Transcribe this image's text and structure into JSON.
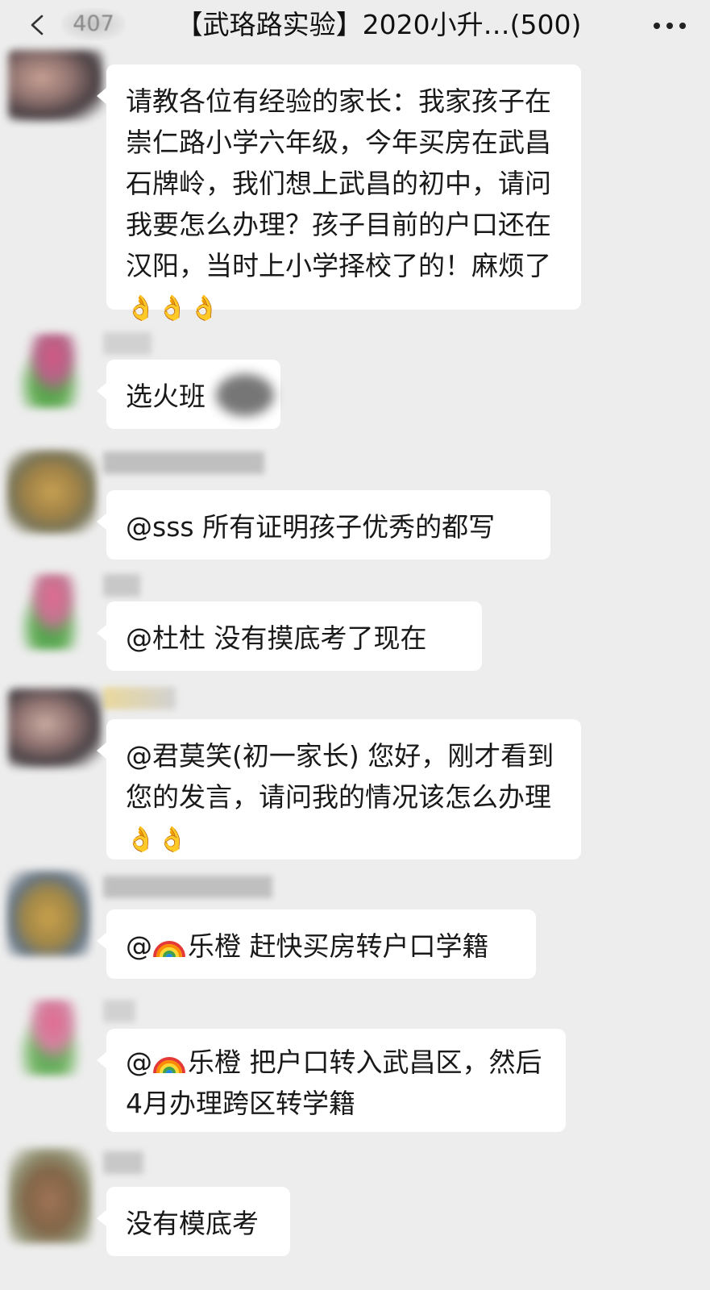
{
  "header": {
    "back_count": "407",
    "title": "【武珞路实验】2020小升…(500)"
  },
  "messages": [
    {
      "text": "请教各位有经验的家长：我家孩子在崇仁路小学六年级，今年买房在武昌石牌岭，我们想上武昌的初中，请问我要怎么办理？孩子目前的户口还在汉阳，当时上小学择校了的！麻烦了",
      "emoji": "👌👌👌"
    },
    {
      "text": "选火班"
    },
    {
      "text": "@sss 所有证明孩子优秀的都写"
    },
    {
      "text": "@杜杜 没有摸底考了现在"
    },
    {
      "text": "@君莫笑(初一家长) 您好，刚才看到您的发言，请问我的情况该怎么办理",
      "emoji": "👌👌"
    },
    {
      "mention_prefix": "@",
      "mention_name": "乐橙",
      "text": " 赶快买房转户口学籍"
    },
    {
      "mention_prefix": "@",
      "mention_name": "乐橙",
      "text": " 把户口转入武昌区，然后4月办理跨区转学籍"
    },
    {
      "text": "没有模底考"
    }
  ],
  "colors": {
    "background": "#ededed",
    "bubble": "#ffffff",
    "text": "#191919"
  },
  "icons": [
    "back-chevron-icon",
    "more-dots-icon",
    "rainbow-emoji-icon",
    "ok-hand-emoji-icon"
  ]
}
